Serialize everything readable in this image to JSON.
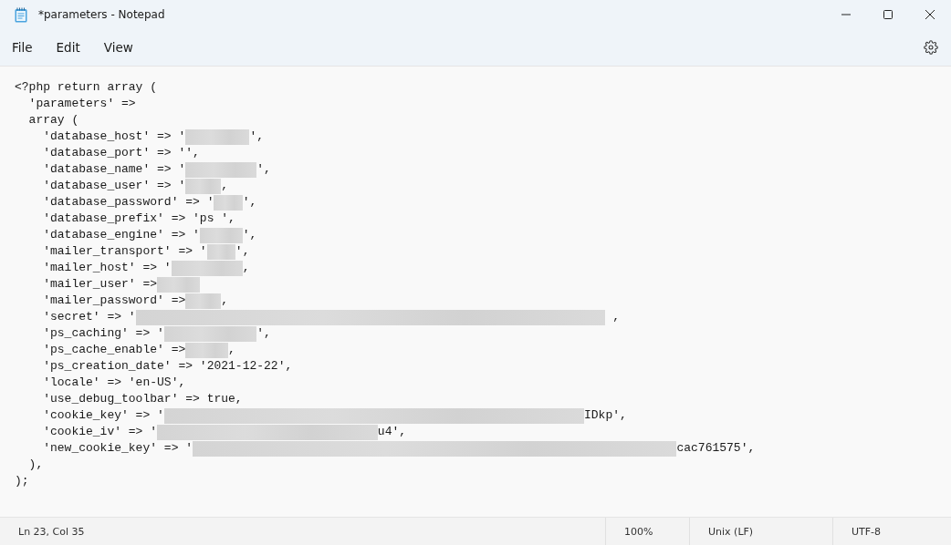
{
  "window": {
    "title": "*parameters - Notepad"
  },
  "menu": [
    "File",
    "Edit",
    "View"
  ],
  "editor": {
    "lines": [
      [
        {
          "kind": "text",
          "text": "<?php return array ("
        }
      ],
      [
        {
          "kind": "text",
          "text": "  'parameters' =>"
        }
      ],
      [
        {
          "kind": "text",
          "text": "  array ("
        }
      ],
      [
        {
          "kind": "text",
          "text": "    'database_host' => '"
        },
        {
          "kind": "redacted"
        },
        {
          "kind": "text",
          "text": "',"
        }
      ],
      [
        {
          "kind": "text",
          "text": "    'database_port' => '',"
        }
      ],
      [
        {
          "kind": "text",
          "text": "    'database_name' => '"
        },
        {
          "kind": "redacted"
        },
        {
          "kind": "text",
          "text": "',"
        }
      ],
      [
        {
          "kind": "text",
          "text": "    'database_user' => '"
        },
        {
          "kind": "redacted"
        },
        {
          "kind": "text",
          "text": ","
        }
      ],
      [
        {
          "kind": "text",
          "text": "    'database_password' => '"
        },
        {
          "kind": "redacted"
        },
        {
          "kind": "text",
          "text": "',"
        }
      ],
      [
        {
          "kind": "text",
          "text": "    'database_prefix' => 'ps ',"
        }
      ],
      [
        {
          "kind": "text",
          "text": "    'database_engine' => '"
        },
        {
          "kind": "redacted"
        },
        {
          "kind": "text",
          "text": "',"
        }
      ],
      [
        {
          "kind": "text",
          "text": "    'mailer_transport' => '"
        },
        {
          "kind": "redacted"
        },
        {
          "kind": "text",
          "text": "',"
        }
      ],
      [
        {
          "kind": "text",
          "text": "    'mailer_host' => '"
        },
        {
          "kind": "redacted"
        },
        {
          "kind": "text",
          "text": ","
        }
      ],
      [
        {
          "kind": "text",
          "text": "    'mailer_user' =>"
        },
        {
          "kind": "redacted"
        }
      ],
      [
        {
          "kind": "text",
          "text": "    'mailer_password' =>"
        },
        {
          "kind": "redacted"
        },
        {
          "kind": "text",
          "text": ","
        }
      ],
      [
        {
          "kind": "text",
          "text": "    'secret' => '"
        },
        {
          "kind": "redacted"
        },
        {
          "kind": "text",
          "text": " ,"
        }
      ],
      [
        {
          "kind": "text",
          "text": "    'ps_caching' => '"
        },
        {
          "kind": "redacted"
        },
        {
          "kind": "text",
          "text": "',"
        }
      ],
      [
        {
          "kind": "text",
          "text": "    'ps_cache_enable' =>"
        },
        {
          "kind": "redacted"
        },
        {
          "kind": "text",
          "text": ","
        }
      ],
      [
        {
          "kind": "text",
          "text": "    'ps_creation_date' => '2021-12-22',"
        }
      ],
      [
        {
          "kind": "text",
          "text": "    'locale' => 'en-US',"
        }
      ],
      [
        {
          "kind": "text",
          "text": "    'use_debug_toolbar' => true,"
        }
      ],
      [
        {
          "kind": "text",
          "text": "    'cookie_key' => '"
        },
        {
          "kind": "redacted"
        },
        {
          "kind": "text",
          "text": "IDkp',"
        }
      ],
      [
        {
          "kind": "text",
          "text": "    'cookie_iv' => '"
        },
        {
          "kind": "redacted"
        },
        {
          "kind": "text",
          "text": "u4',"
        }
      ],
      [
        {
          "kind": "text",
          "text": "    'new_cookie_key' => '"
        },
        {
          "kind": "redacted"
        },
        {
          "kind": "text",
          "text": "cac761575',"
        }
      ],
      [
        {
          "kind": "text",
          "text": "  ),"
        }
      ],
      [
        {
          "kind": "text",
          "text": ");"
        }
      ]
    ]
  },
  "status_bar": {
    "position": "Ln 23, Col 35",
    "zoom": "100%",
    "line_endings": "Unix (LF)",
    "encoding": "UTF-8"
  }
}
